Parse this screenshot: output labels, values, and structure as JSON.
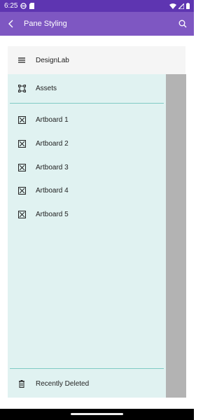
{
  "status_bar": {
    "time": "6:25",
    "icons": [
      "data-saver-icon",
      "sim-card-icon",
      "wifi-icon",
      "signal-icon",
      "battery-icon"
    ]
  },
  "app_bar": {
    "title": "Pane Styling",
    "back_icon": "chevron-left-icon",
    "search_icon": "search-icon"
  },
  "nav_pane": {
    "header": {
      "label": "DesignLab",
      "icon": "hamburger-menu-icon"
    },
    "items": [
      {
        "label": "Assets",
        "icon": "selection-frame-icon"
      },
      {
        "label": "Artboard 1",
        "icon": "artboard-icon"
      },
      {
        "label": "Artboard 2",
        "icon": "artboard-icon"
      },
      {
        "label": "Artboard 3",
        "icon": "artboard-icon"
      },
      {
        "label": "Artboard 4",
        "icon": "artboard-icon"
      },
      {
        "label": "Artboard 5",
        "icon": "artboard-icon"
      }
    ],
    "footer": {
      "label": "Recently Deleted",
      "icon": "trash-icon"
    }
  },
  "colors": {
    "status_bar": "#5e35b1",
    "app_bar": "#7e57c2",
    "pane_background": "#e0f2f1",
    "pane_header": "#f5f5f5",
    "divider": "#80cbc4",
    "overlay": "#b3b3b3"
  }
}
